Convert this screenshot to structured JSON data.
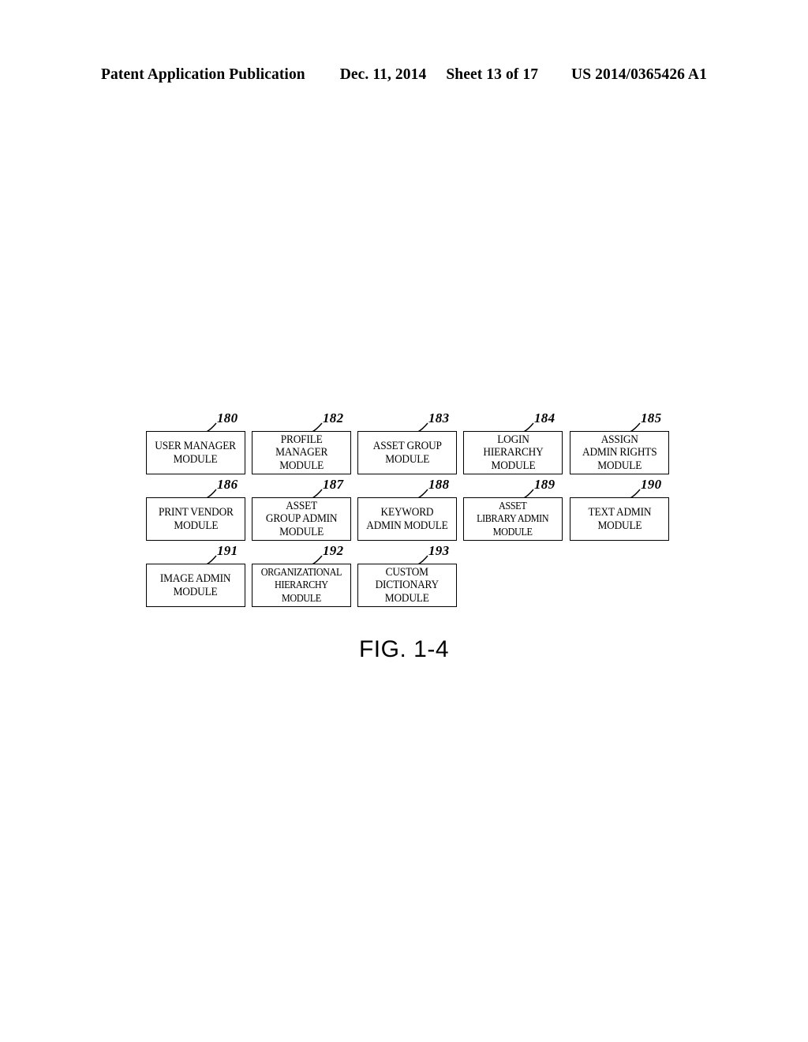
{
  "header": {
    "publication": "Patent Application Publication",
    "date": "Dec. 11, 2014",
    "sheet": "Sheet 13 of 17",
    "doc_number": "US 2014/0365426 A1"
  },
  "figure": {
    "caption": "FIG. 1-4",
    "stroke_color": "#000000",
    "background_color": "#ffffff",
    "rows": [
      {
        "nodes": [
          {
            "ref": "180",
            "label": "USER MANAGER\nMODULE"
          },
          {
            "ref": "182",
            "label": "PROFILE\nMANAGER\nMODULE"
          },
          {
            "ref": "183",
            "label": "ASSET GROUP\nMODULE"
          },
          {
            "ref": "184",
            "label": "LOGIN\nHIERARCHY\nMODULE"
          },
          {
            "ref": "185",
            "label": "ASSIGN\nADMIN RIGHTS\nMODULE"
          }
        ]
      },
      {
        "nodes": [
          {
            "ref": "186",
            "label": "PRINT VENDOR\nMODULE"
          },
          {
            "ref": "187",
            "label": "ASSET\nGROUP ADMIN\nMODULE"
          },
          {
            "ref": "188",
            "label": "KEYWORD\nADMIN MODULE"
          },
          {
            "ref": "189",
            "label": "ASSET\nLIBRARY ADMIN\nMODULE"
          },
          {
            "ref": "190",
            "label": "TEXT ADMIN\nMODULE"
          }
        ]
      },
      {
        "nodes": [
          {
            "ref": "191",
            "label": "IMAGE ADMIN\nMODULE"
          },
          {
            "ref": "192",
            "label": "ORGANIZATIONAL\nHIERARCHY\nMODULE"
          },
          {
            "ref": "193",
            "label": "CUSTOM\nDICTIONARY\nMODULE"
          }
        ]
      }
    ]
  }
}
